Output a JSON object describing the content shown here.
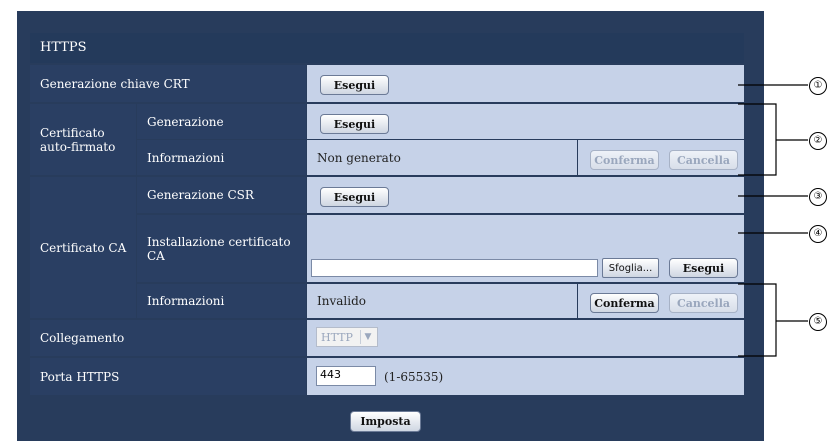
{
  "section_title": "HTTPS",
  "rows": {
    "crt_key": {
      "label": "Generazione chiave CRT",
      "button": "Esegui"
    },
    "self_signed": {
      "label": "Certificato auto-firmato",
      "generation": {
        "label": "Generazione",
        "button": "Esegui"
      },
      "info": {
        "label": "Informazioni",
        "value": "Non generato",
        "confirm": "Conferma",
        "delete": "Cancella"
      }
    },
    "ca": {
      "label": "Certificato CA",
      "csr": {
        "label": "Generazione CSR",
        "button": "Esegui"
      },
      "install": {
        "label": "Installazione certificato CA",
        "file_value": "",
        "browse": "Sfoglia...",
        "button": "Esegui"
      },
      "info": {
        "label": "Informazioni",
        "value": "Invalido",
        "confirm": "Conferma",
        "delete": "Cancella"
      }
    },
    "connection": {
      "label": "Collegamento",
      "value": "HTTP"
    },
    "port": {
      "label": "Porta HTTPS",
      "value": "443",
      "range": "(1-65535)"
    }
  },
  "apply_button": "Imposta",
  "callouts": [
    "①",
    "②",
    "③",
    "④",
    "⑤"
  ],
  "colors": {
    "panel": "#283c5c",
    "label_bg": "#2a3f63",
    "value_bg": "#c6d2e8"
  }
}
